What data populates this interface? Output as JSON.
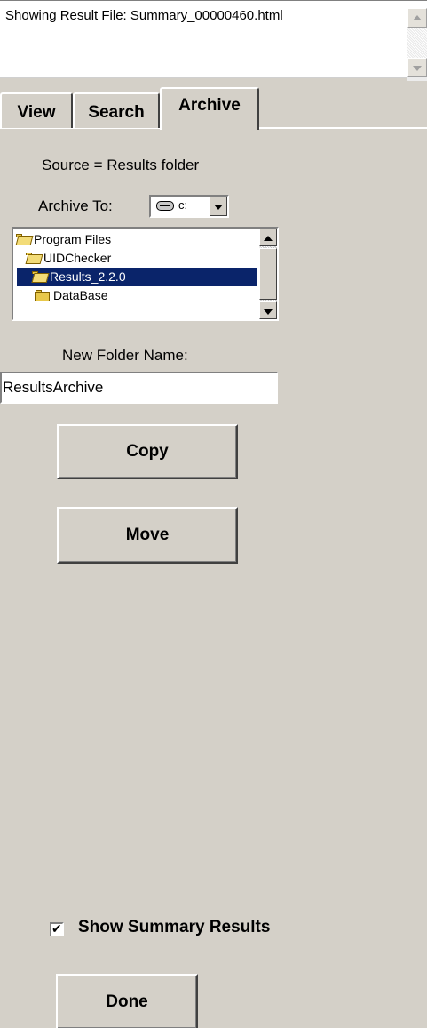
{
  "status": {
    "text": "Showing Result File: Summary_00000460.html"
  },
  "tabs": [
    {
      "label": "View",
      "active": false
    },
    {
      "label": "Search",
      "active": false
    },
    {
      "label": "Archive",
      "active": true
    }
  ],
  "archive": {
    "source_label": "Source = Results folder",
    "archive_to_label": "Archive To:",
    "drive": {
      "value": "c:",
      "icon": "drive-icon"
    },
    "folders": [
      {
        "name": "Program Files",
        "icon": "open-folder-icon",
        "selected": false
      },
      {
        "name": "UIDChecker",
        "icon": "open-folder-icon",
        "selected": false
      },
      {
        "name": "Results_2.2.0",
        "icon": "open-folder-icon",
        "selected": true
      },
      {
        "name": "DataBase",
        "icon": "folder-icon",
        "selected": false
      }
    ],
    "new_folder_label": "New Folder Name:",
    "new_folder_value": "ResultsArchive",
    "copy_label": "Copy",
    "move_label": "Move"
  },
  "footer": {
    "show_summary_label": "Show Summary Results",
    "show_summary_checked": true,
    "checkmark": "✔",
    "done_label": "Done"
  },
  "colors": {
    "panel": "#d4d0c8",
    "selection": "#0a246a",
    "folder": "#e8c84a"
  }
}
